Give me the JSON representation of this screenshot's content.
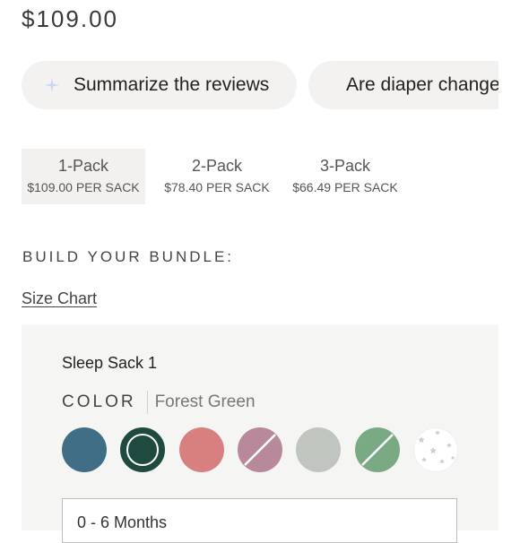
{
  "product": {
    "price": "$109.00"
  },
  "suggestions": [
    {
      "label": "Summarize the reviews",
      "icon": "sparkle-icon"
    },
    {
      "label": "Are diaper changes easy?",
      "icon": "sparkle-icon"
    }
  ],
  "packs": [
    {
      "label": "1-Pack",
      "price": "$109.00 PER SACK",
      "selected": true
    },
    {
      "label": "2-Pack",
      "price": "$78.40 PER SACK",
      "selected": false
    },
    {
      "label": "3-Pack",
      "price": "$66.49 PER SACK",
      "selected": false
    }
  ],
  "bundle": {
    "heading": "BUILD YOUR BUNDLE:",
    "size_chart": "Size Chart"
  },
  "sack": {
    "title": "Sleep Sack 1",
    "color_label": "COLOR",
    "color_value": "Forest Green",
    "swatches": [
      {
        "name": "Slate Blue",
        "color": "#3f6e86",
        "available": true,
        "selected": false
      },
      {
        "name": "Forest Green",
        "color": "#1f4a40",
        "available": true,
        "selected": true
      },
      {
        "name": "Rose",
        "color": "#d7807f",
        "available": true,
        "selected": false
      },
      {
        "name": "Mauve",
        "color": "#b7899b",
        "available": false,
        "selected": false
      },
      {
        "name": "Sage Grey",
        "color": "#c0c5c0",
        "available": true,
        "selected": false
      },
      {
        "name": "Sage Green",
        "color": "#7aaa83",
        "available": false,
        "selected": false
      },
      {
        "name": "Stars",
        "color": "#ffffff",
        "pattern_color": "#c9cdd2",
        "available": true,
        "selected": false
      }
    ],
    "size_value": "0 - 6 Months"
  },
  "colors": {
    "accent_spark": "#c9d8ef",
    "selected_pack_bg": "#f2f1ef",
    "panel_bg": "#f5f5f4"
  }
}
